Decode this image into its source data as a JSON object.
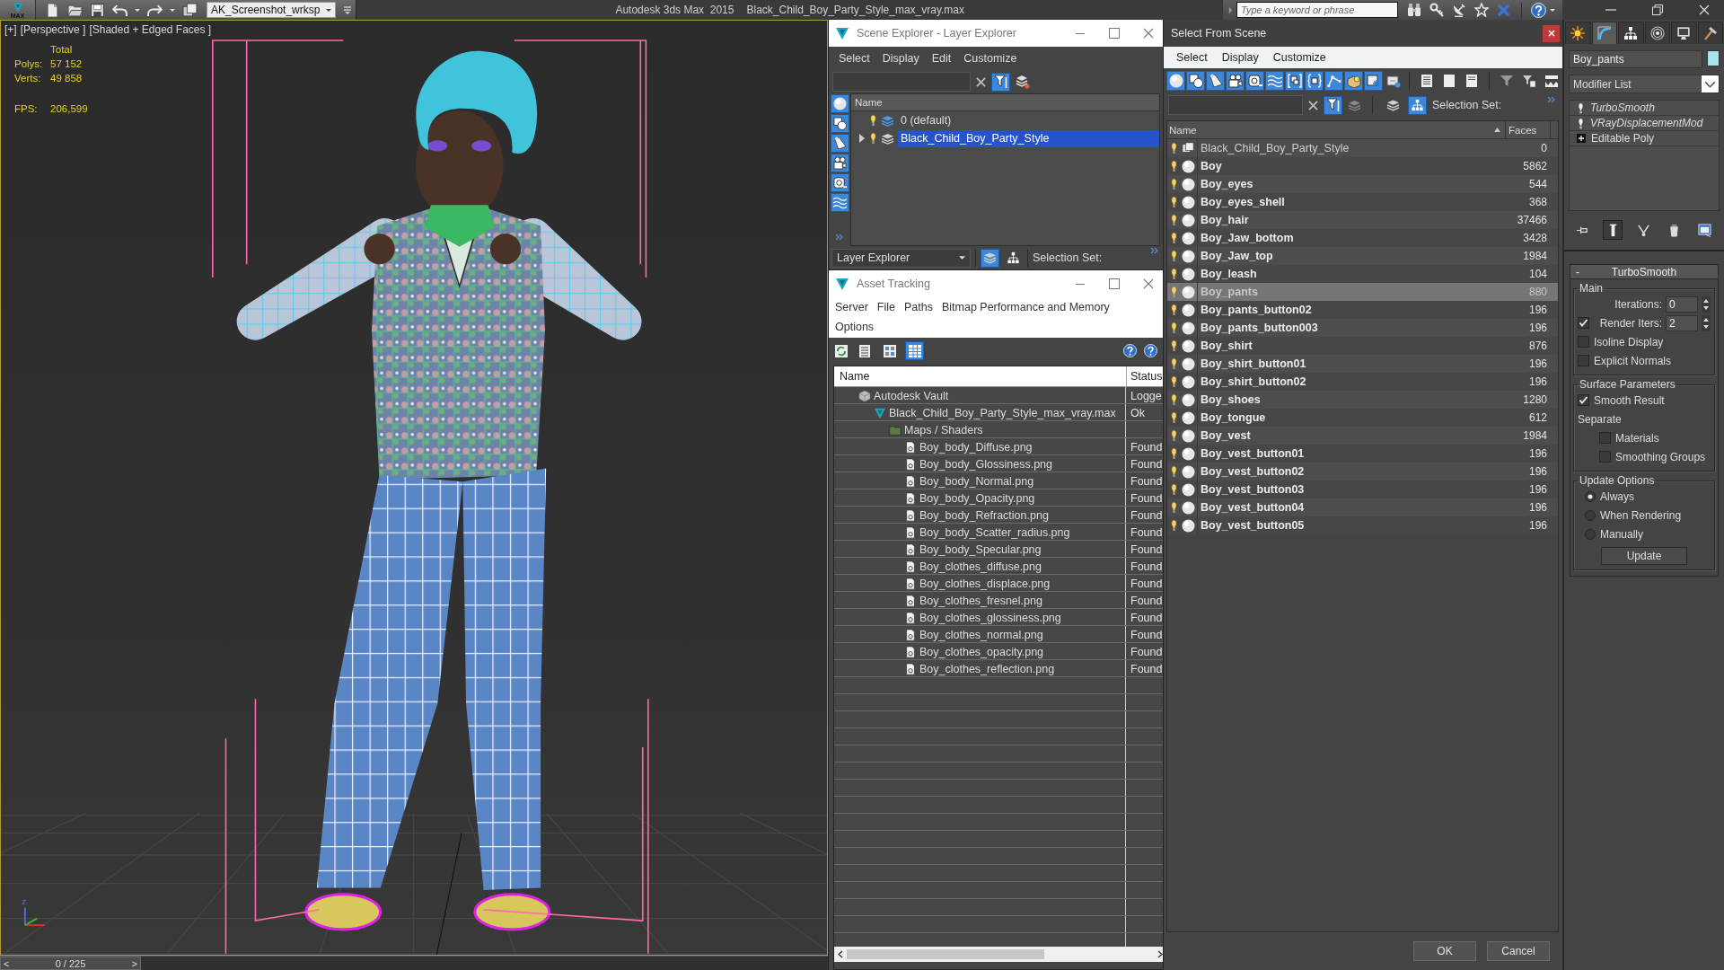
{
  "title_bar": {
    "logo": "MAX",
    "workspace": "AK_Screenshot_wrksp",
    "app_title": "Autodesk 3ds Max  2015",
    "file_title": "Black_Child_Boy_Party_Style_max_vray.max",
    "search": {
      "placeholder": "Type a keyword or phrase"
    }
  },
  "viewport": {
    "active": true,
    "menus": [
      "[+]",
      "[Perspective ]",
      "[Shaded + Edged Faces ]"
    ],
    "stats": {
      "header": "Total",
      "rows": [
        {
          "label": "Polys:",
          "value": "57 152"
        },
        {
          "label": "Verts:",
          "value": "49 858"
        }
      ],
      "fps": {
        "label": "FPS:",
        "value": "206,599"
      }
    },
    "axis_label": "z"
  },
  "time_slider": {
    "back": "<",
    "position": "0 / 225",
    "forward": ">",
    "level": 0
  },
  "scene_explorer": {
    "title": "Scene Explorer - Layer Explorer",
    "menu": [
      "Select",
      "Display",
      "Edit",
      "Customize"
    ],
    "filter_on": true,
    "type_filters": [
      {
        "kind": "geometry",
        "on": true
      },
      {
        "kind": "shapes",
        "on": true
      },
      {
        "kind": "lights",
        "on": true
      },
      {
        "kind": "cameras",
        "on": true
      },
      {
        "kind": "helpers",
        "on": true
      },
      {
        "kind": "space_warps",
        "on": true
      }
    ],
    "column": "Name",
    "layers": [
      {
        "name": "0 (default)",
        "current": true,
        "expander": false,
        "selected": false
      },
      {
        "name": "Black_Child_Boy_Party_Style",
        "current": false,
        "expander": true,
        "selected": true
      }
    ],
    "explorer_type": "Layer Explorer",
    "view_toggles": [
      {
        "kind": "layers",
        "on": true
      },
      {
        "kind": "hierarchy",
        "on": false
      }
    ],
    "selection_set_label": "Selection Set:"
  },
  "asset_tracking": {
    "title": "Asset Tracking",
    "menu": [
      "Server",
      "File",
      "Paths",
      "Bitmap Performance and Memory",
      "Options"
    ],
    "view_modes": [
      {
        "kind": "list",
        "selected": false
      },
      {
        "kind": "thumbnails",
        "selected": false
      },
      {
        "kind": "table",
        "selected": true
      }
    ],
    "columns": [
      "Name",
      "Status"
    ],
    "tree": [
      {
        "kind": "vault",
        "name": "Autodesk Vault",
        "status": "Logge",
        "children": [
          {
            "kind": "scene_file",
            "name": "Black_Child_Boy_Party_Style_max_vray.max",
            "status": "Ok",
            "children": [
              {
                "kind": "folder",
                "name": "Maps / Shaders",
                "children": [
                  {
                    "kind": "bitmap",
                    "name": "Boy_body_Diffuse.png",
                    "status": "Found"
                  },
                  {
                    "kind": "bitmap",
                    "name": "Boy_body_Glossiness.png",
                    "status": "Found"
                  },
                  {
                    "kind": "bitmap",
                    "name": "Boy_body_Normal.png",
                    "status": "Found"
                  },
                  {
                    "kind": "bitmap",
                    "name": "Boy_body_Opacity.png",
                    "status": "Found"
                  },
                  {
                    "kind": "bitmap",
                    "name": "Boy_body_Refraction.png",
                    "status": "Found"
                  },
                  {
                    "kind": "bitmap",
                    "name": "Boy_body_Scatter_radius.png",
                    "status": "Found"
                  },
                  {
                    "kind": "bitmap",
                    "name": "Boy_body_Specular.png",
                    "status": "Found"
                  },
                  {
                    "kind": "bitmap",
                    "name": "Boy_clothes_diffuse.png",
                    "status": "Found"
                  },
                  {
                    "kind": "bitmap",
                    "name": "Boy_clothes_displace.png",
                    "status": "Found"
                  },
                  {
                    "kind": "bitmap",
                    "name": "Boy_clothes_fresnel.png",
                    "status": "Found"
                  },
                  {
                    "kind": "bitmap",
                    "name": "Boy_clothes_glossiness.png",
                    "status": "Found"
                  },
                  {
                    "kind": "bitmap",
                    "name": "Boy_clothes_normal.png",
                    "status": "Found"
                  },
                  {
                    "kind": "bitmap",
                    "name": "Boy_clothes_opacity.png",
                    "status": "Found"
                  },
                  {
                    "kind": "bitmap",
                    "name": "Boy_clothes_reflection.png",
                    "status": "Found"
                  }
                ]
              }
            ]
          }
        ]
      }
    ]
  },
  "select_from_scene": {
    "title": "Select From Scene",
    "menu": [
      "Select",
      "Display",
      "Customize"
    ],
    "type_filters": [
      {
        "kind": "geometry",
        "on": true
      },
      {
        "kind": "shapes",
        "on": true
      },
      {
        "kind": "lights",
        "on": true
      },
      {
        "kind": "cameras",
        "on": true
      },
      {
        "kind": "helpers",
        "on": true
      },
      {
        "kind": "space_warps",
        "on": true
      },
      {
        "kind": "groups",
        "on": true
      },
      {
        "kind": "xrefs",
        "on": true
      },
      {
        "kind": "bones",
        "on": true
      },
      {
        "kind": "containers",
        "on": true
      },
      {
        "kind": "frozen",
        "on": true
      },
      {
        "kind": "hidden",
        "on": false
      }
    ],
    "filter_on": true,
    "view_toggles": [
      {
        "kind": "layers",
        "on": false
      },
      {
        "kind": "hierarchy",
        "on": true
      }
    ],
    "selection_set_label": "Selection Set:",
    "columns": [
      "Name",
      "Faces"
    ],
    "rows": [
      {
        "kind": "layer",
        "name": "Black_Child_Boy_Party_Style",
        "faces": "0",
        "selected": false
      },
      {
        "kind": "object",
        "name": "Boy",
        "faces": "5862",
        "selected": false
      },
      {
        "kind": "object",
        "name": "Boy_eyes",
        "faces": "544",
        "selected": false
      },
      {
        "kind": "object",
        "name": "Boy_eyes_shell",
        "faces": "368",
        "selected": false
      },
      {
        "kind": "object",
        "name": "Boy_hair",
        "faces": "37466",
        "selected": false
      },
      {
        "kind": "object",
        "name": "Boy_Jaw_bottom",
        "faces": "3428",
        "selected": false
      },
      {
        "kind": "object",
        "name": "Boy_Jaw_top",
        "faces": "1984",
        "selected": false
      },
      {
        "kind": "object",
        "name": "Boy_leash",
        "faces": "104",
        "selected": false
      },
      {
        "kind": "object",
        "name": "Boy_pants",
        "faces": "880",
        "selected": true
      },
      {
        "kind": "object",
        "name": "Boy_pants_button02",
        "faces": "196",
        "selected": false
      },
      {
        "kind": "object",
        "name": "Boy_pants_button003",
        "faces": "196",
        "selected": false
      },
      {
        "kind": "object",
        "name": "Boy_shirt",
        "faces": "876",
        "selected": false
      },
      {
        "kind": "object",
        "name": "Boy_shirt_button01",
        "faces": "196",
        "selected": false
      },
      {
        "kind": "object",
        "name": "Boy_shirt_button02",
        "faces": "196",
        "selected": false
      },
      {
        "kind": "object",
        "name": "Boy_shoes",
        "faces": "1280",
        "selected": false
      },
      {
        "kind": "object",
        "name": "Boy_tongue",
        "faces": "612",
        "selected": false
      },
      {
        "kind": "object",
        "name": "Boy_vest",
        "faces": "1984",
        "selected": false
      },
      {
        "kind": "object",
        "name": "Boy_vest_button01",
        "faces": "196",
        "selected": false
      },
      {
        "kind": "object",
        "name": "Boy_vest_button02",
        "faces": "196",
        "selected": false
      },
      {
        "kind": "object",
        "name": "Boy_vest_button03",
        "faces": "196",
        "selected": false
      },
      {
        "kind": "object",
        "name": "Boy_vest_button04",
        "faces": "196",
        "selected": false
      },
      {
        "kind": "object",
        "name": "Boy_vest_button05",
        "faces": "196",
        "selected": false
      }
    ],
    "buttons": [
      "OK",
      "Cancel"
    ]
  },
  "command_panel": {
    "tabs": [
      {
        "kind": "create",
        "selected": false
      },
      {
        "kind": "modify",
        "selected": true
      },
      {
        "kind": "hierarchy",
        "selected": false
      },
      {
        "kind": "motion",
        "selected": false
      },
      {
        "kind": "display",
        "selected": false
      },
      {
        "kind": "utilities",
        "selected": false
      }
    ],
    "object_name": "Boy_pants",
    "modifier_list": "Modifier List",
    "stack": [
      {
        "kind": "modifier",
        "name": "TurboSmooth",
        "instanced": true
      },
      {
        "kind": "modifier",
        "name": "VRayDisplacementMod",
        "instanced": true
      },
      {
        "kind": "base_object",
        "name": "Editable Poly",
        "instanced": false
      }
    ],
    "stack_tools": [
      {
        "kind": "pin",
        "on": false
      },
      {
        "kind": "show_end_result",
        "on": true
      },
      {
        "kind": "make_unique",
        "on": false
      },
      {
        "kind": "remove",
        "on": false
      },
      {
        "kind": "configure",
        "on": false
      }
    ],
    "rollout": {
      "collapse": "-",
      "title": "TurboSmooth",
      "groups": [
        {
          "title": "Main",
          "controls": [
            {
              "kind": "spinner",
              "label": "Iterations:",
              "value": "0"
            },
            {
              "kind": "check_spinner",
              "label": "Render Iters:",
              "value": "2",
              "checked": true
            },
            {
              "kind": "checkbox",
              "label": "Isoline Display",
              "checked": false
            },
            {
              "kind": "checkbox",
              "label": "Explicit Normals",
              "checked": false
            }
          ]
        },
        {
          "title": "Surface Parameters",
          "controls": [
            {
              "kind": "checkbox",
              "label": "Smooth Result",
              "checked": true
            },
            {
              "kind": "label",
              "label": "Separate",
              "children": [
                {
                  "kind": "checkbox",
                  "label": "Materials",
                  "checked": false
                },
                {
                  "kind": "checkbox",
                  "label": "Smoothing Groups",
                  "checked": false
                }
              ]
            }
          ]
        },
        {
          "title": "Update Options",
          "controls": [
            {
              "kind": "radio",
              "label": "Always",
              "selected": true
            },
            {
              "kind": "radio",
              "label": "When Rendering",
              "selected": false
            },
            {
              "kind": "radio",
              "label": "Manually",
              "selected": false
            },
            {
              "kind": "button",
              "label": "Update"
            }
          ]
        }
      ]
    }
  }
}
